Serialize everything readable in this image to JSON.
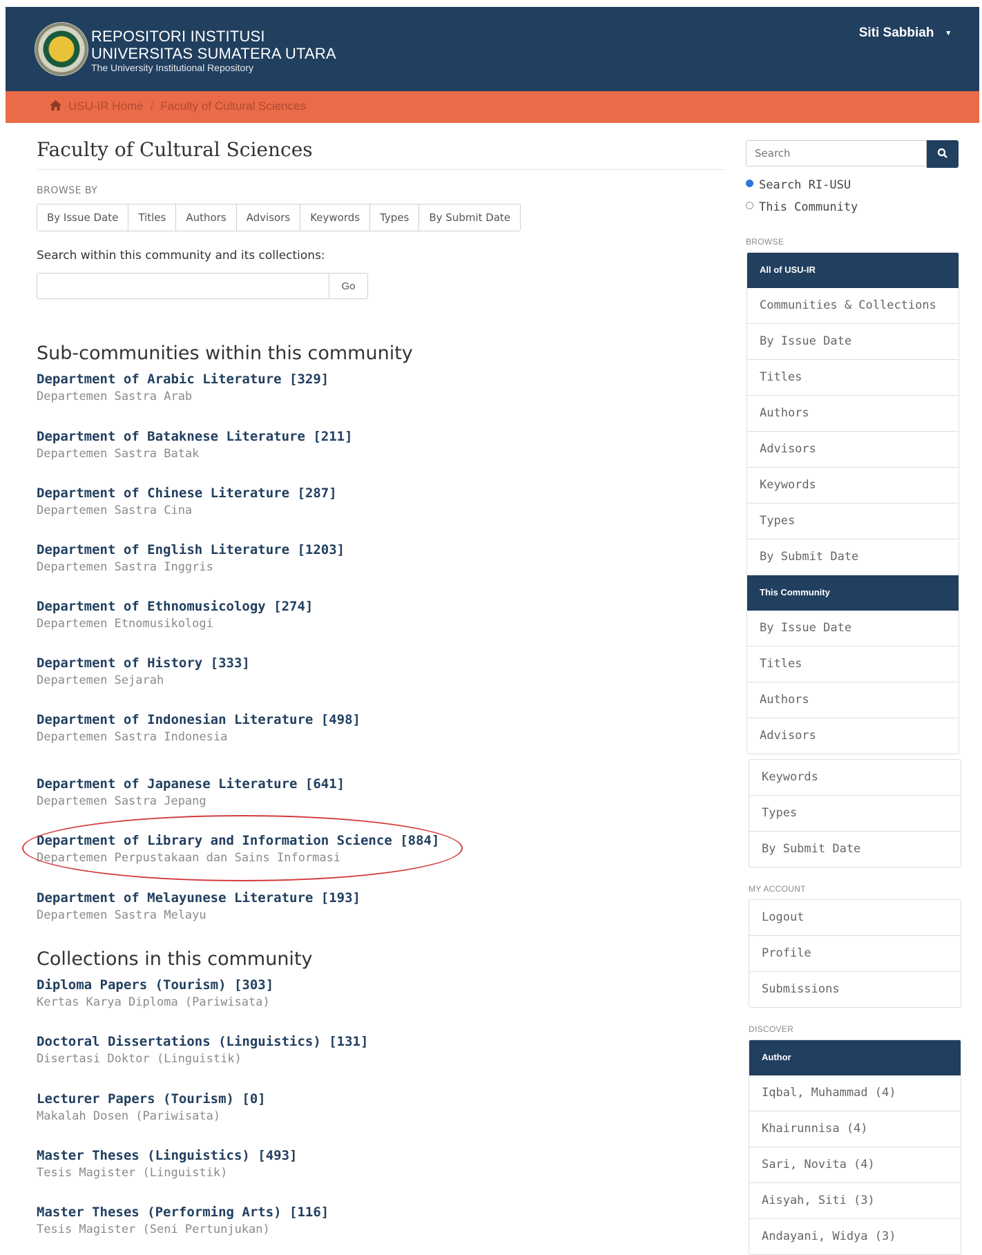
{
  "header": {
    "title_line1": "REPOSITORI INSTITUSI",
    "title_line2": "UNIVERSITAS SUMATERA UTARA",
    "subtitle": "The University Institutional Repository",
    "user": "Siti Sabbiah"
  },
  "breadcrumb": {
    "home": "USU-IR Home",
    "separator": "/",
    "current": "Faculty of Cultural Sciences"
  },
  "page": {
    "title": "Faculty of Cultural Sciences",
    "browse_label": "BROWSE BY",
    "browse_buttons": [
      "By Issue Date",
      "Titles",
      "Authors",
      "Advisors",
      "Keywords",
      "Types",
      "By Submit Date"
    ],
    "search_within_label": "Search within this community and its collections:",
    "search_within_value": "",
    "go_label": "Go"
  },
  "subcommunities": {
    "heading": "Sub-communities within this community",
    "items": [
      {
        "name": "Department of Arabic Literature [329]",
        "desc": "Departemen Sastra Arab"
      },
      {
        "name": "Department of Bataknese Literature [211]",
        "desc": "Departemen Sastra Batak"
      },
      {
        "name": "Department of Chinese Literature [287]",
        "desc": "Departemen Sastra Cina"
      },
      {
        "name": "Department of English Literature [1203]",
        "desc": "Departemen Sastra Inggris"
      },
      {
        "name": "Department of Ethnomusicology [274]",
        "desc": "Departemen Etnomusikologi"
      },
      {
        "name": "Department of History [333]",
        "desc": "Departemen Sejarah"
      },
      {
        "name": "Department of Indonesian Literature [498]",
        "desc": "Departemen Sastra Indonesia"
      },
      {
        "name": "Department of Japanese Literature [641]",
        "desc": "Departemen Sastra Jepang"
      },
      {
        "name": "Department of Library and Information Science [884]",
        "desc": "Departemen Perpustakaan dan Sains Informasi"
      },
      {
        "name": "Department of Melayunese Literature [193]",
        "desc": "Departemen Sastra Melayu"
      }
    ]
  },
  "collections": {
    "heading": "Collections in this community",
    "items": [
      {
        "name": "Diploma Papers (Tourism) [303]",
        "desc": "Kertas Karya Diploma (Pariwisata)"
      },
      {
        "name": "Doctoral Dissertations (Linguistics) [131]",
        "desc": "Disertasi Doktor (Linguistik)"
      },
      {
        "name": "Lecturer Papers (Tourism) [0]",
        "desc": "Makalah Dosen (Pariwisata)"
      },
      {
        "name": "Master Theses (Linguistics) [493]",
        "desc": "Tesis Magister (Linguistik)"
      },
      {
        "name": "Master Theses (Performing Arts) [116]",
        "desc": "Tesis Magister (Seni Pertunjukan)"
      }
    ]
  },
  "sidebar": {
    "search_placeholder": "Search",
    "radio_all": "Search RI-USU",
    "radio_community": "This Community",
    "browse_label": "BROWSE",
    "all_head": "All of USU-IR",
    "all_items": [
      "Communities & Collections",
      "By Issue Date",
      "Titles",
      "Authors",
      "Advisors",
      "Keywords",
      "Types",
      "By Submit Date"
    ],
    "community_head": "This Community",
    "community_items": [
      "By Issue Date",
      "Titles",
      "Authors",
      "Advisors"
    ],
    "community_items_2": [
      "Keywords",
      "Types",
      "By Submit Date"
    ],
    "account_label": "MY ACCOUNT",
    "account_items": [
      "Logout",
      "Profile",
      "Submissions"
    ],
    "discover_label": "DISCOVER",
    "discover_head": "Author",
    "discover_items": [
      "Iqbal, Muhammad (4)",
      "Khairunnisa (4)",
      "Sari, Novita (4)",
      "Aisyah, Siti (3)",
      "Andayani, Widya (3)"
    ]
  },
  "colors": {
    "navy": "#213f5f",
    "orange": "#e96b48",
    "highlight": "#d23b3b"
  }
}
